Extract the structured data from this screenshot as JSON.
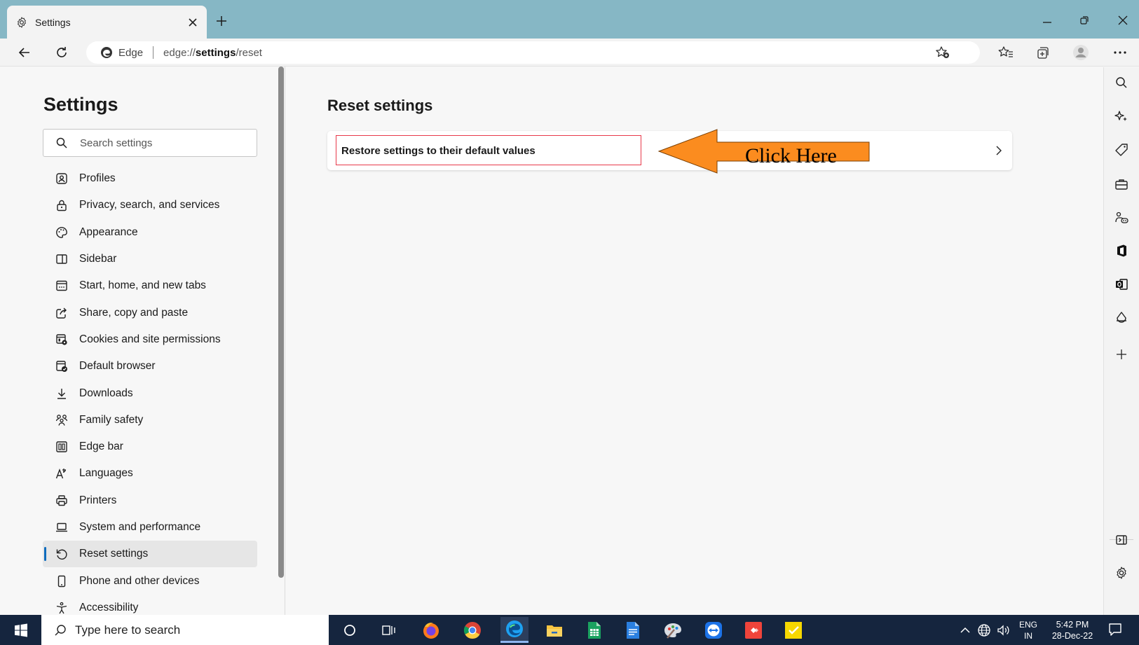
{
  "browser": {
    "tab_title": "Settings",
    "address": {
      "browser_label": "Edge",
      "url_prefix": "edge://",
      "url_bold": "settings",
      "url_suffix": "/reset"
    }
  },
  "sidebar": {
    "title": "Settings",
    "search_placeholder": "Search settings",
    "items": [
      {
        "label": "Profiles",
        "icon": "profile-icon"
      },
      {
        "label": "Privacy, search, and services",
        "icon": "lock-icon"
      },
      {
        "label": "Appearance",
        "icon": "palette-icon"
      },
      {
        "label": "Sidebar",
        "icon": "sidebar-icon"
      },
      {
        "label": "Start, home, and new tabs",
        "icon": "home-tabs-icon"
      },
      {
        "label": "Share, copy and paste",
        "icon": "share-icon"
      },
      {
        "label": "Cookies and site permissions",
        "icon": "cookies-icon"
      },
      {
        "label": "Default browser",
        "icon": "default-browser-icon"
      },
      {
        "label": "Downloads",
        "icon": "download-icon"
      },
      {
        "label": "Family safety",
        "icon": "family-icon"
      },
      {
        "label": "Edge bar",
        "icon": "edge-bar-icon"
      },
      {
        "label": "Languages",
        "icon": "language-icon"
      },
      {
        "label": "Printers",
        "icon": "printer-icon"
      },
      {
        "label": "System and performance",
        "icon": "laptop-icon"
      },
      {
        "label": "Reset settings",
        "icon": "reset-icon",
        "active": true
      },
      {
        "label": "Phone and other devices",
        "icon": "phone-icon"
      },
      {
        "label": "Accessibility",
        "icon": "accessibility-icon"
      }
    ]
  },
  "main": {
    "title": "Reset settings",
    "card_label": "Restore settings to their default values",
    "annotation": "Click Here"
  },
  "taskbar": {
    "search_placeholder": "Type here to search",
    "lang_top": "ENG",
    "lang_bottom": "IN",
    "time": "5:42 PM",
    "date": "28-Dec-22"
  },
  "colors": {
    "titlebar": "#86b7c5",
    "active_indicator": "#0f6cbd",
    "highlight_border": "#e8394a",
    "callout_arrow": "#fb8c1f",
    "taskbar": "#15253e"
  }
}
